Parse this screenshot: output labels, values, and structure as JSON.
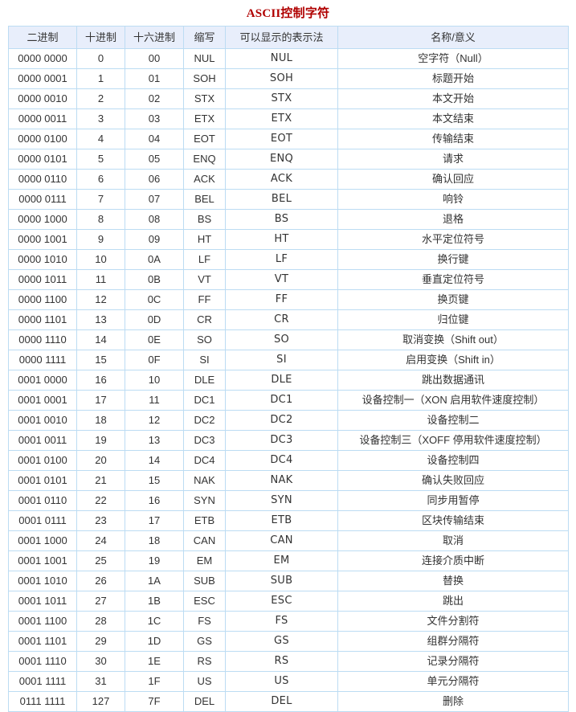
{
  "page": {
    "title": "ASCII控制字符",
    "title_color": "#b00000",
    "header_bg": "#e8eefb",
    "border_color": "#bcdcf3"
  },
  "table": {
    "columns": [
      {
        "key": "binary",
        "label": "二进制"
      },
      {
        "key": "decimal",
        "label": "十进制"
      },
      {
        "key": "hex",
        "label": "十六进制"
      },
      {
        "key": "abbr",
        "label": "缩写"
      },
      {
        "key": "display",
        "label": "可以显示的表示法"
      },
      {
        "key": "name",
        "label": "名称/意义"
      }
    ],
    "rows": [
      {
        "binary": "0000 0000",
        "decimal": "0",
        "hex": "00",
        "abbr": "NUL",
        "display": "NUL",
        "name": "空字符（Null）"
      },
      {
        "binary": "0000 0001",
        "decimal": "1",
        "hex": "01",
        "abbr": "SOH",
        "display": "SOH",
        "name": "标题开始"
      },
      {
        "binary": "0000 0010",
        "decimal": "2",
        "hex": "02",
        "abbr": "STX",
        "display": "STX",
        "name": "本文开始"
      },
      {
        "binary": "0000 0011",
        "decimal": "3",
        "hex": "03",
        "abbr": "ETX",
        "display": "ETX",
        "name": "本文结束"
      },
      {
        "binary": "0000 0100",
        "decimal": "4",
        "hex": "04",
        "abbr": "EOT",
        "display": "EOT",
        "name": "传输结束"
      },
      {
        "binary": "0000 0101",
        "decimal": "5",
        "hex": "05",
        "abbr": "ENQ",
        "display": "ENQ",
        "name": "请求"
      },
      {
        "binary": "0000 0110",
        "decimal": "6",
        "hex": "06",
        "abbr": "ACK",
        "display": "ACK",
        "name": "确认回应"
      },
      {
        "binary": "0000 0111",
        "decimal": "7",
        "hex": "07",
        "abbr": "BEL",
        "display": "BEL",
        "name": "响铃"
      },
      {
        "binary": "0000 1000",
        "decimal": "8",
        "hex": "08",
        "abbr": "BS",
        "display": "BS",
        "name": "退格"
      },
      {
        "binary": "0000 1001",
        "decimal": "9",
        "hex": "09",
        "abbr": "HT",
        "display": "HT",
        "name": "水平定位符号"
      },
      {
        "binary": "0000 1010",
        "decimal": "10",
        "hex": "0A",
        "abbr": "LF",
        "display": "LF",
        "name": "换行键"
      },
      {
        "binary": "0000 1011",
        "decimal": "11",
        "hex": "0B",
        "abbr": "VT",
        "display": "VT",
        "name": "垂直定位符号"
      },
      {
        "binary": "0000 1100",
        "decimal": "12",
        "hex": "0C",
        "abbr": "FF",
        "display": "FF",
        "name": "换页键"
      },
      {
        "binary": "0000 1101",
        "decimal": "13",
        "hex": "0D",
        "abbr": "CR",
        "display": "CR",
        "name": "归位键"
      },
      {
        "binary": "0000 1110",
        "decimal": "14",
        "hex": "0E",
        "abbr": "SO",
        "display": "SO",
        "name": "取消变换（Shift out）"
      },
      {
        "binary": "0000 1111",
        "decimal": "15",
        "hex": "0F",
        "abbr": "SI",
        "display": "SI",
        "name": "启用变换（Shift in）"
      },
      {
        "binary": "0001 0000",
        "decimal": "16",
        "hex": "10",
        "abbr": "DLE",
        "display": "DLE",
        "name": "跳出数据通讯"
      },
      {
        "binary": "0001 0001",
        "decimal": "17",
        "hex": "11",
        "abbr": "DC1",
        "display": "DC1",
        "name": "设备控制一（XON 启用软件速度控制）"
      },
      {
        "binary": "0001 0010",
        "decimal": "18",
        "hex": "12",
        "abbr": "DC2",
        "display": "DC2",
        "name": "设备控制二"
      },
      {
        "binary": "0001 0011",
        "decimal": "19",
        "hex": "13",
        "abbr": "DC3",
        "display": "DC3",
        "name": "设备控制三（XOFF 停用软件速度控制）"
      },
      {
        "binary": "0001 0100",
        "decimal": "20",
        "hex": "14",
        "abbr": "DC4",
        "display": "DC4",
        "name": "设备控制四"
      },
      {
        "binary": "0001 0101",
        "decimal": "21",
        "hex": "15",
        "abbr": "NAK",
        "display": "NAK",
        "name": "确认失败回应"
      },
      {
        "binary": "0001 0110",
        "decimal": "22",
        "hex": "16",
        "abbr": "SYN",
        "display": "SYN",
        "name": "同步用暂停"
      },
      {
        "binary": "0001 0111",
        "decimal": "23",
        "hex": "17",
        "abbr": "ETB",
        "display": "ETB",
        "name": "区块传输结束"
      },
      {
        "binary": "0001 1000",
        "decimal": "24",
        "hex": "18",
        "abbr": "CAN",
        "display": "CAN",
        "name": "取消"
      },
      {
        "binary": "0001 1001",
        "decimal": "25",
        "hex": "19",
        "abbr": "EM",
        "display": "EM",
        "name": "连接介质中断"
      },
      {
        "binary": "0001 1010",
        "decimal": "26",
        "hex": "1A",
        "abbr": "SUB",
        "display": "SUB",
        "name": "替换"
      },
      {
        "binary": "0001 1011",
        "decimal": "27",
        "hex": "1B",
        "abbr": "ESC",
        "display": "ESC",
        "name": "跳出"
      },
      {
        "binary": "0001 1100",
        "decimal": "28",
        "hex": "1C",
        "abbr": "FS",
        "display": "FS",
        "name": "文件分割符"
      },
      {
        "binary": "0001 1101",
        "decimal": "29",
        "hex": "1D",
        "abbr": "GS",
        "display": "GS",
        "name": "组群分隔符"
      },
      {
        "binary": "0001 1110",
        "decimal": "30",
        "hex": "1E",
        "abbr": "RS",
        "display": "RS",
        "name": "记录分隔符"
      },
      {
        "binary": "0001 1111",
        "decimal": "31",
        "hex": "1F",
        "abbr": "US",
        "display": "US",
        "name": "单元分隔符"
      },
      {
        "binary": "0111 1111",
        "decimal": "127",
        "hex": "7F",
        "abbr": "DEL",
        "display": "DEL",
        "name": "删除"
      }
    ]
  }
}
